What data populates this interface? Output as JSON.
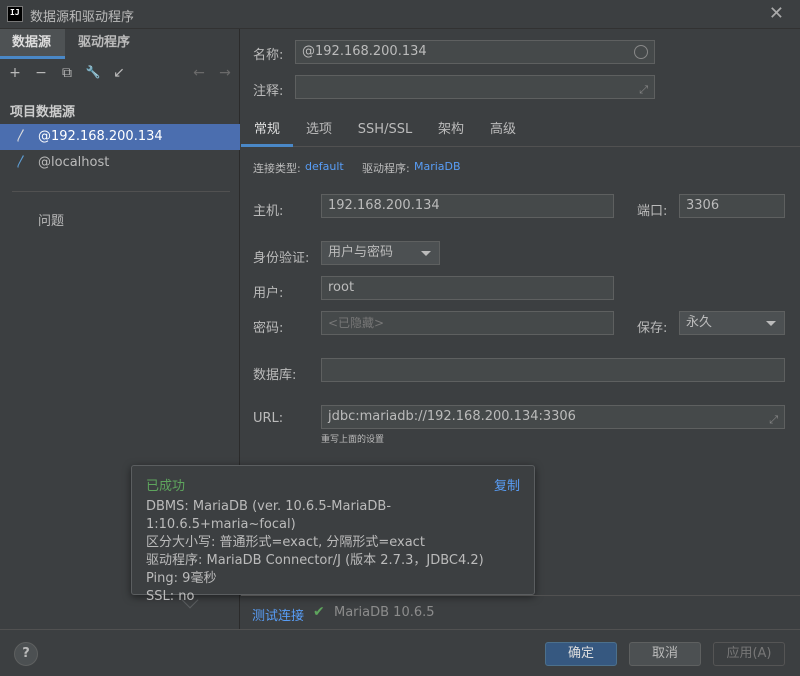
{
  "window": {
    "title": "数据源和驱动程序",
    "app_icon_text": "IJ"
  },
  "left": {
    "tabs": [
      "数据源",
      "驱动程序"
    ],
    "toolbar": [
      "+",
      "−",
      "⧉",
      "🔧",
      "↙",
      "←",
      "→"
    ],
    "section_title": "项目数据源",
    "datasources": [
      {
        "label": "@192.168.200.134",
        "icon": "mariadb-icon",
        "selected": true
      },
      {
        "label": "@localhost",
        "icon": "mariadb-icon",
        "selected": false
      }
    ],
    "problems_label": "问题"
  },
  "form": {
    "name_label": "名称:",
    "name_value": "@192.168.200.134",
    "comment_label": "注释:",
    "comment_value": ""
  },
  "tabs": [
    "常规",
    "选项",
    "SSH/SSL",
    "架构",
    "高级"
  ],
  "general": {
    "conn_type_label": "连接类型:",
    "conn_type_value": "default",
    "driver_label": "驱动程序:",
    "driver_value": "MariaDB",
    "host_label": "主机:",
    "host_value": "192.168.200.134",
    "port_label": "端口:",
    "port_value": "3306",
    "auth_label": "身份验证:",
    "auth_value": "用户与密码",
    "user_label": "用户:",
    "user_value": "root",
    "password_label": "密码:",
    "password_placeholder": "<已隐藏>",
    "save_label": "保存:",
    "save_value": "永久",
    "database_label": "数据库:",
    "database_value": "",
    "url_label": "URL:",
    "url_value": "jdbc:mariadb://192.168.200.134:3306",
    "url_hint": "重写上面的设置"
  },
  "popup": {
    "status": "已成功",
    "copy_label": "复制",
    "lines": [
      "DBMS: MariaDB (ver. 10.6.5-MariaDB-1:10.6.5+maria~focal)",
      "区分大小写: 普通形式=exact, 分隔形式=exact",
      "驱动程序: MariaDB Connector/J (版本 2.7.3，JDBC4.2)",
      "Ping: 9毫秒",
      "SSL: no"
    ]
  },
  "test": {
    "link_label": "测试连接",
    "result": "MariaDB 10.6.5"
  },
  "buttons": {
    "help": "?",
    "ok": "确定",
    "cancel": "取消",
    "apply": "应用(A)"
  },
  "colors": {
    "accent": "#4a88c7",
    "selection": "#4b6eaf",
    "link": "#589df6",
    "success": "#5ea55d"
  }
}
